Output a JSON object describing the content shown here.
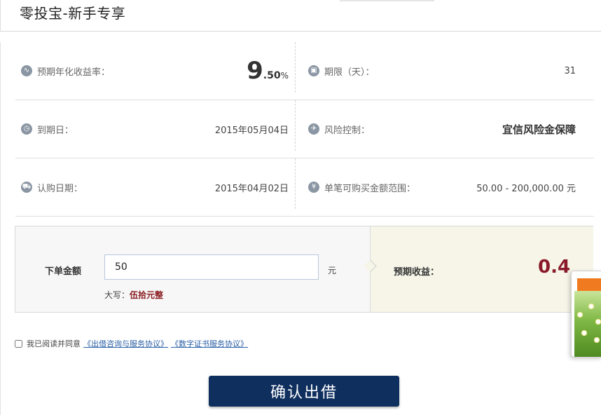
{
  "header": {
    "title": "零投宝-新手专享"
  },
  "info": {
    "rate_label": "预期年化收益率：",
    "rate_int": "9",
    "rate_dec": ".50",
    "rate_pct": "%",
    "term_label": "期限（天）：",
    "term_value": "31",
    "due_label": "到期日：",
    "due_value": "2015年05月04日",
    "risk_label": "风险控制：",
    "risk_value": "宜信风险金保障",
    "purchase_label": "认购日期：",
    "purchase_value": "2015年04月02日",
    "range_label": "单笔可购买金额范围：",
    "range_value": "50.00 - 200,000.00 元"
  },
  "order": {
    "amount_label": "下单金额",
    "amount_value": "50",
    "unit": "元",
    "capital_label": "大写：",
    "capital_value": "伍拾元整",
    "expected_label": "预期收益：",
    "expected_value": "0.4"
  },
  "agreement": {
    "text": "我已阅读并同意",
    "link1": "《出借咨询与服务协议》",
    "link2": "《数字证书服务协议》"
  },
  "confirm": {
    "label": "确认出借"
  }
}
